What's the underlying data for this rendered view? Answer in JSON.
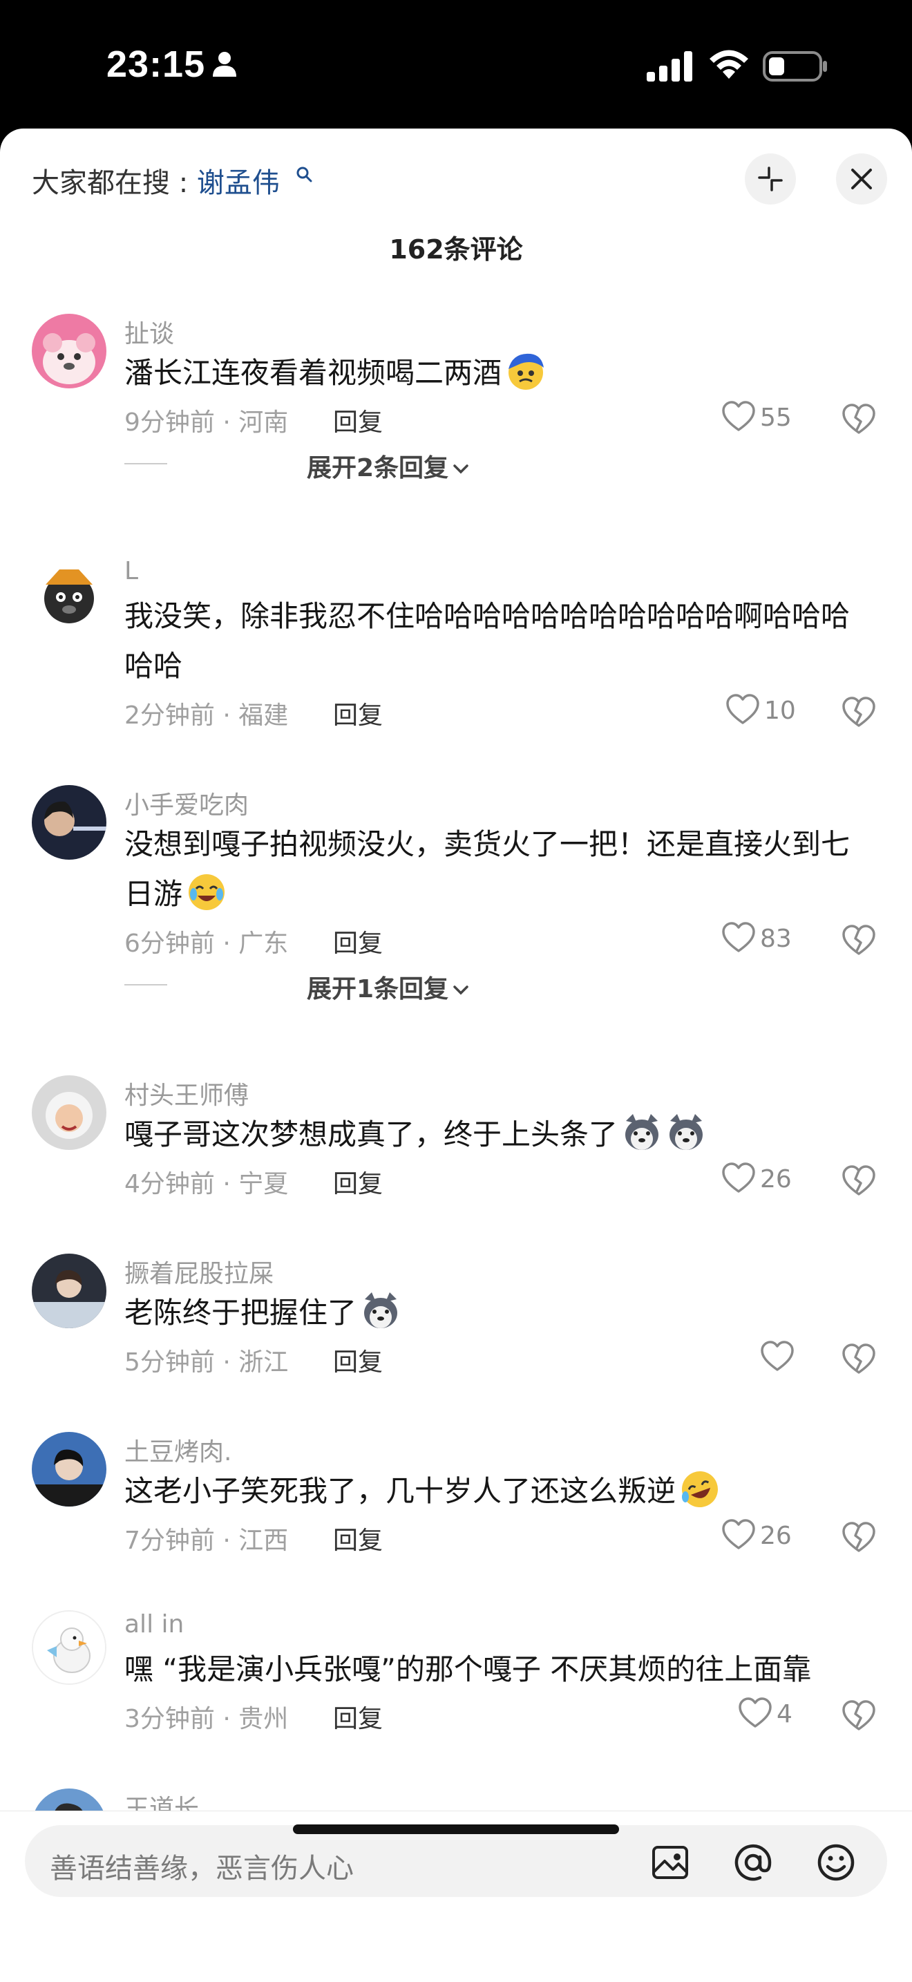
{
  "status_bar": {
    "time": "23:15"
  },
  "header": {
    "hot_search_prefix": "大家都在搜 : ",
    "hot_search_keyword": "谢孟伟",
    "comment_count": "162条评论"
  },
  "comments": [
    {
      "name": "扯谈",
      "text": "潘长江连夜看着视频喝二两酒",
      "meta": "9分钟前 · 河南",
      "reply": "回复",
      "likes": "55",
      "expand": "展开2条回复"
    },
    {
      "name": "L",
      "text": "我没笑，除非我忍不住哈哈哈哈哈哈哈哈哈哈哈啊哈哈哈哈哈",
      "meta": "2分钟前 · 福建",
      "reply": "回复",
      "likes": "10"
    },
    {
      "name": "小手爱吃肉",
      "text": "没想到嘎子拍视频没火，卖货火了一把！还是直接火到七日游",
      "meta": "6分钟前 · 广东",
      "reply": "回复",
      "likes": "83",
      "expand": "展开1条回复"
    },
    {
      "name": "村头王师傅",
      "text": "嘎子哥这次梦想成真了，终于上头条了",
      "meta": "4分钟前 · 宁夏",
      "reply": "回复",
      "likes": "26"
    },
    {
      "name": "撅着屁股拉屎",
      "text": "老陈终于把握住了",
      "meta": "5分钟前 · 浙江",
      "reply": "回复",
      "likes": ""
    },
    {
      "name": "土豆烤肉.",
      "text": "这老小子笑死我了，几十岁人了还这么叛逆",
      "meta": "7分钟前 · 江西",
      "reply": "回复",
      "likes": "26"
    },
    {
      "name": "all in",
      "text": "嘿 “我是演小兵张嘎”的那个嘎子 不厌其烦的往上面靠",
      "meta": "3分钟前 · 贵州",
      "reply": "回复",
      "likes": "4"
    },
    {
      "name": "王道长"
    }
  ],
  "input": {
    "placeholder": "善语结善缘，恶言伤人心"
  },
  "icons": [
    "person-icon",
    "signal-icon",
    "wifi-icon",
    "battery-icon",
    "search-icon",
    "collapse-icon",
    "close-icon",
    "heart-icon",
    "broken-heart-icon",
    "chevron-down-icon",
    "image-icon",
    "at-icon",
    "emoji-icon"
  ]
}
